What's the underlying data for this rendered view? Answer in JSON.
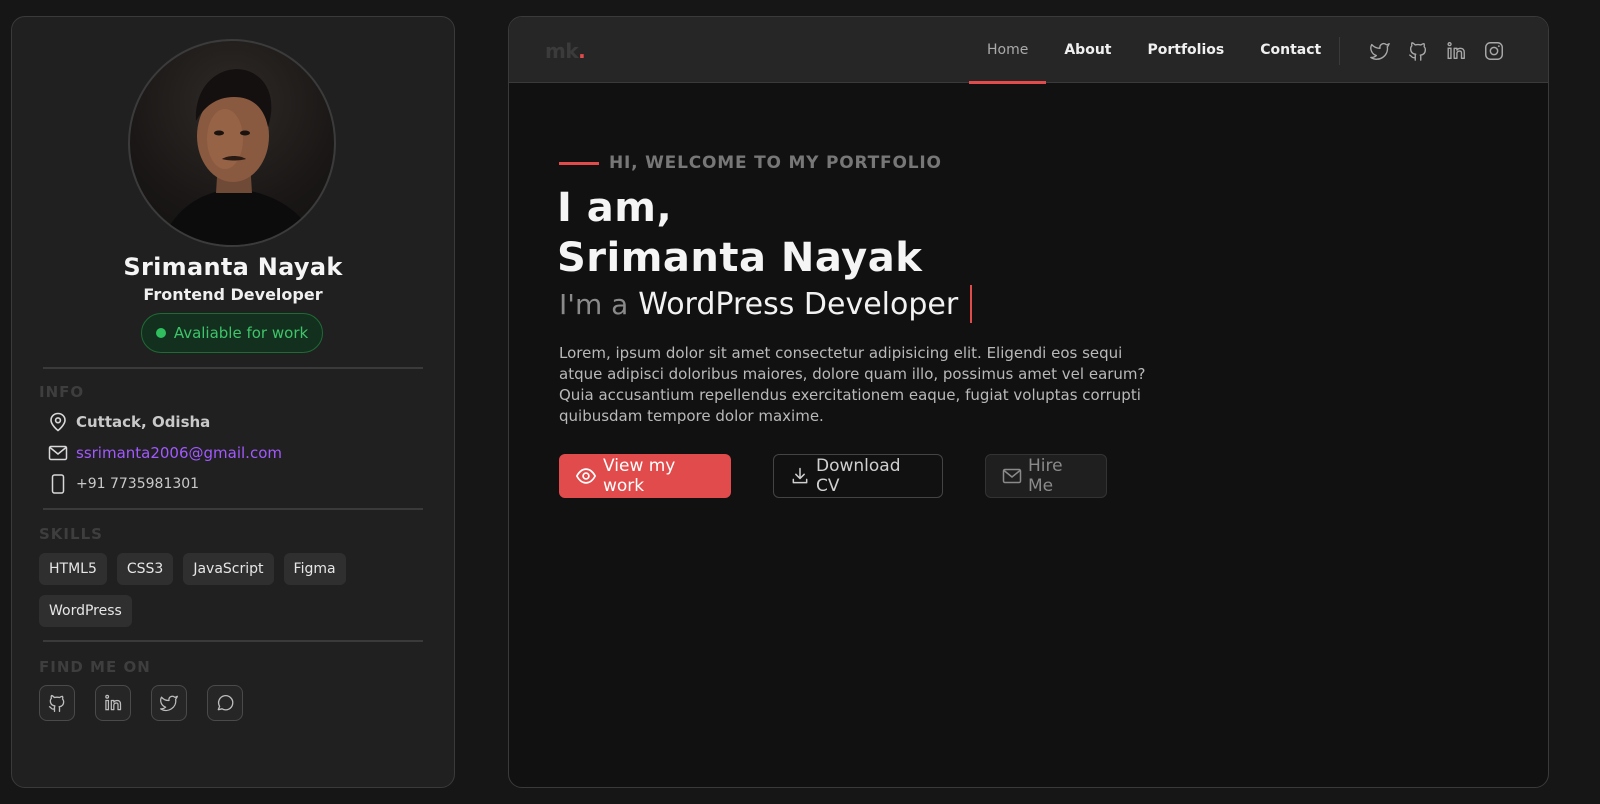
{
  "profile": {
    "name": "Srimanta Nayak",
    "role": "Frontend Developer",
    "status": "Avaliable for work",
    "info_title": "INFO",
    "location": "Cuttack, Odisha",
    "email": "ssrimanta2006@gmail.com",
    "phone": "+91 7735981301",
    "skills_title": "SKILLS",
    "skills": [
      "HTML5",
      "CSS3",
      "JavaScript",
      "Figma",
      "WordPress"
    ],
    "find_title": "FIND ME ON",
    "socials": [
      "github-icon",
      "linkedin-icon",
      "twitter-icon",
      "chat-icon"
    ]
  },
  "nav": {
    "logo": "mk",
    "logo_dot": ".",
    "links": [
      {
        "label": "Home",
        "active": true
      },
      {
        "label": "About",
        "active": false
      },
      {
        "label": "Portfolios",
        "active": false
      },
      {
        "label": "Contact",
        "active": false
      }
    ],
    "icons": [
      "twitter-icon",
      "github-icon",
      "linkedin-icon",
      "instagram-icon"
    ]
  },
  "hero": {
    "eyebrow": "HI, WELCOME TO MY PORTFOLIO",
    "line1": "I am,",
    "line2": "Srimanta Nayak",
    "prefix": "I'm a",
    "role": "WordPress Developer",
    "intro": "Lorem, ipsum dolor sit amet consectetur adipisicing elit. Eligendi eos sequi atque adipisci doloribus maiores, dolore quam illo, possimus amet vel earum? Quia accusantium repellendus exercitationem eaque, fugiat voluptas corrupti quibusdam tempore dolor maxime.",
    "buttons": {
      "view_work": "View my work",
      "download_cv": "Download CV",
      "hire_me": "Hire Me"
    }
  },
  "colors": {
    "accent": "#e24b4b",
    "status_green": "#3ec46a",
    "email_purple": "#a259ff",
    "background": "#161616"
  }
}
